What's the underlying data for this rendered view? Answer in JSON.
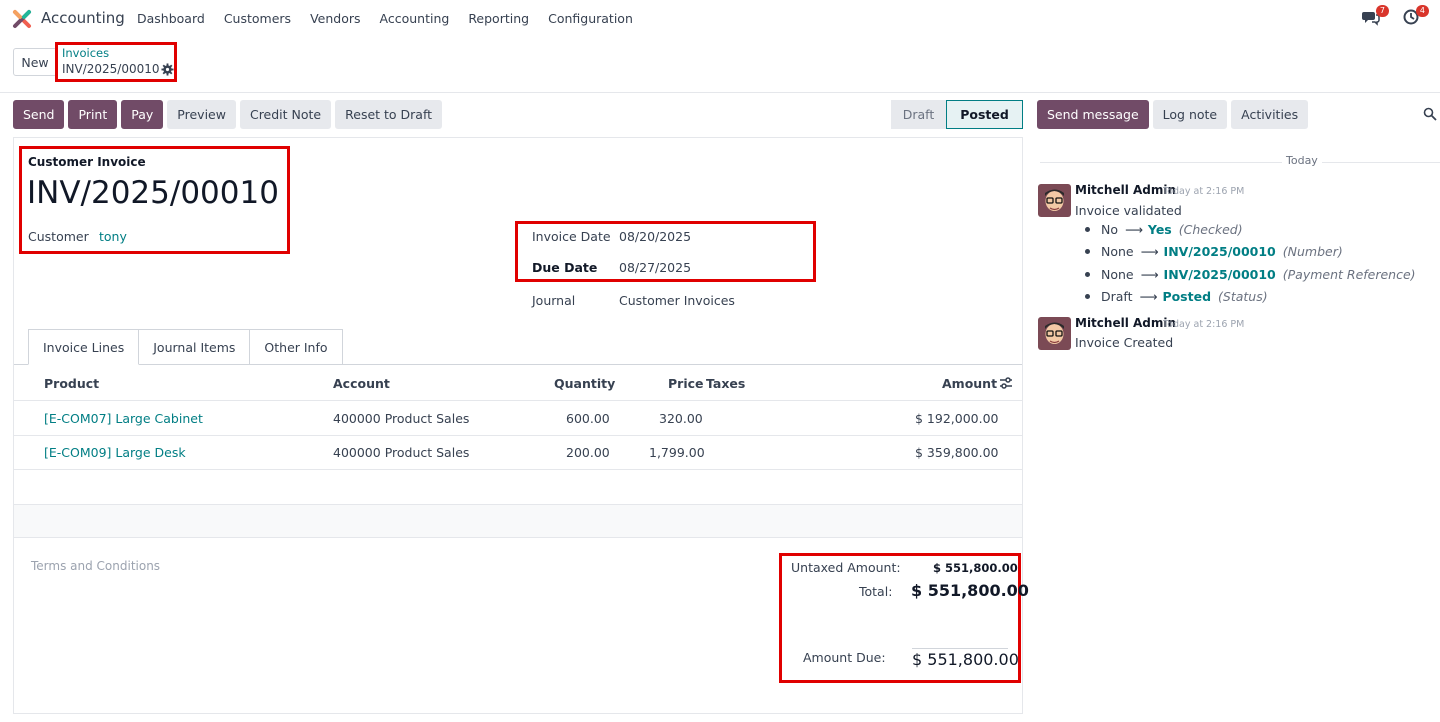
{
  "topbar": {
    "app_name": "Accounting",
    "menu": [
      "Dashboard",
      "Customers",
      "Vendors",
      "Accounting",
      "Reporting",
      "Configuration"
    ],
    "messages_badge": "7",
    "activities_badge": "4",
    "logo_colors": [
      "#f06050",
      "#714b67",
      "#21b799",
      "#f4a261"
    ]
  },
  "breadcrumb": {
    "new_label": "New",
    "parent": "Invoices",
    "current": "INV/2025/00010"
  },
  "actions": {
    "send": "Send",
    "print": "Print",
    "pay": "Pay",
    "preview": "Preview",
    "credit_note": "Credit Note",
    "reset": "Reset to Draft"
  },
  "status": {
    "draft": "Draft",
    "posted": "Posted",
    "active": "Posted"
  },
  "invoice": {
    "type": "Customer Invoice",
    "name": "INV/2025/00010",
    "customer_label": "Customer",
    "customer": "tony",
    "invoice_date_label": "Invoice Date",
    "invoice_date": "08/20/2025",
    "due_date_label": "Due Date",
    "due_date": "08/27/2025",
    "journal_label": "Journal",
    "journal": "Customer Invoices"
  },
  "tabs": [
    "Invoice Lines",
    "Journal Items",
    "Other Info"
  ],
  "lines": {
    "headers": {
      "product": "Product",
      "account": "Account",
      "quantity": "Quantity",
      "price": "Price",
      "taxes": "Taxes",
      "amount": "Amount"
    },
    "rows": [
      {
        "product": "[E-COM07] Large Cabinet",
        "account": "400000 Product Sales",
        "quantity": "600.00",
        "price": "320.00",
        "amount": "$ 192,000.00"
      },
      {
        "product": "[E-COM09] Large Desk",
        "account": "400000 Product Sales",
        "quantity": "200.00",
        "price": "1,799.00",
        "amount": "$ 359,800.00"
      }
    ]
  },
  "terms_placeholder": "Terms and Conditions",
  "totals": {
    "untaxed_label": "Untaxed Amount:",
    "untaxed": "$ 551,800.00",
    "total_label": "Total:",
    "total": "$ 551,800.00",
    "due_label": "Amount Due:",
    "due": "$ 551,800.00"
  },
  "chatter": {
    "send_message": "Send message",
    "log_note": "Log note",
    "activities": "Activities",
    "today": "Today",
    "messages": [
      {
        "author": "Mitchell Admin",
        "time": "Today at 2:16 PM",
        "body": "Invoice validated",
        "tracking": [
          {
            "old": "No",
            "new": "Yes",
            "field": "(Checked)"
          },
          {
            "old": "None",
            "new": "INV/2025/00010",
            "field": "(Number)"
          },
          {
            "old": "None",
            "new": "INV/2025/00010",
            "field": "(Payment Reference)"
          },
          {
            "old": "Draft",
            "new": "Posted",
            "field": "(Status)"
          }
        ]
      },
      {
        "author": "Mitchell Admin",
        "time": "Today at 2:16 PM",
        "body": "Invoice Created"
      }
    ]
  }
}
